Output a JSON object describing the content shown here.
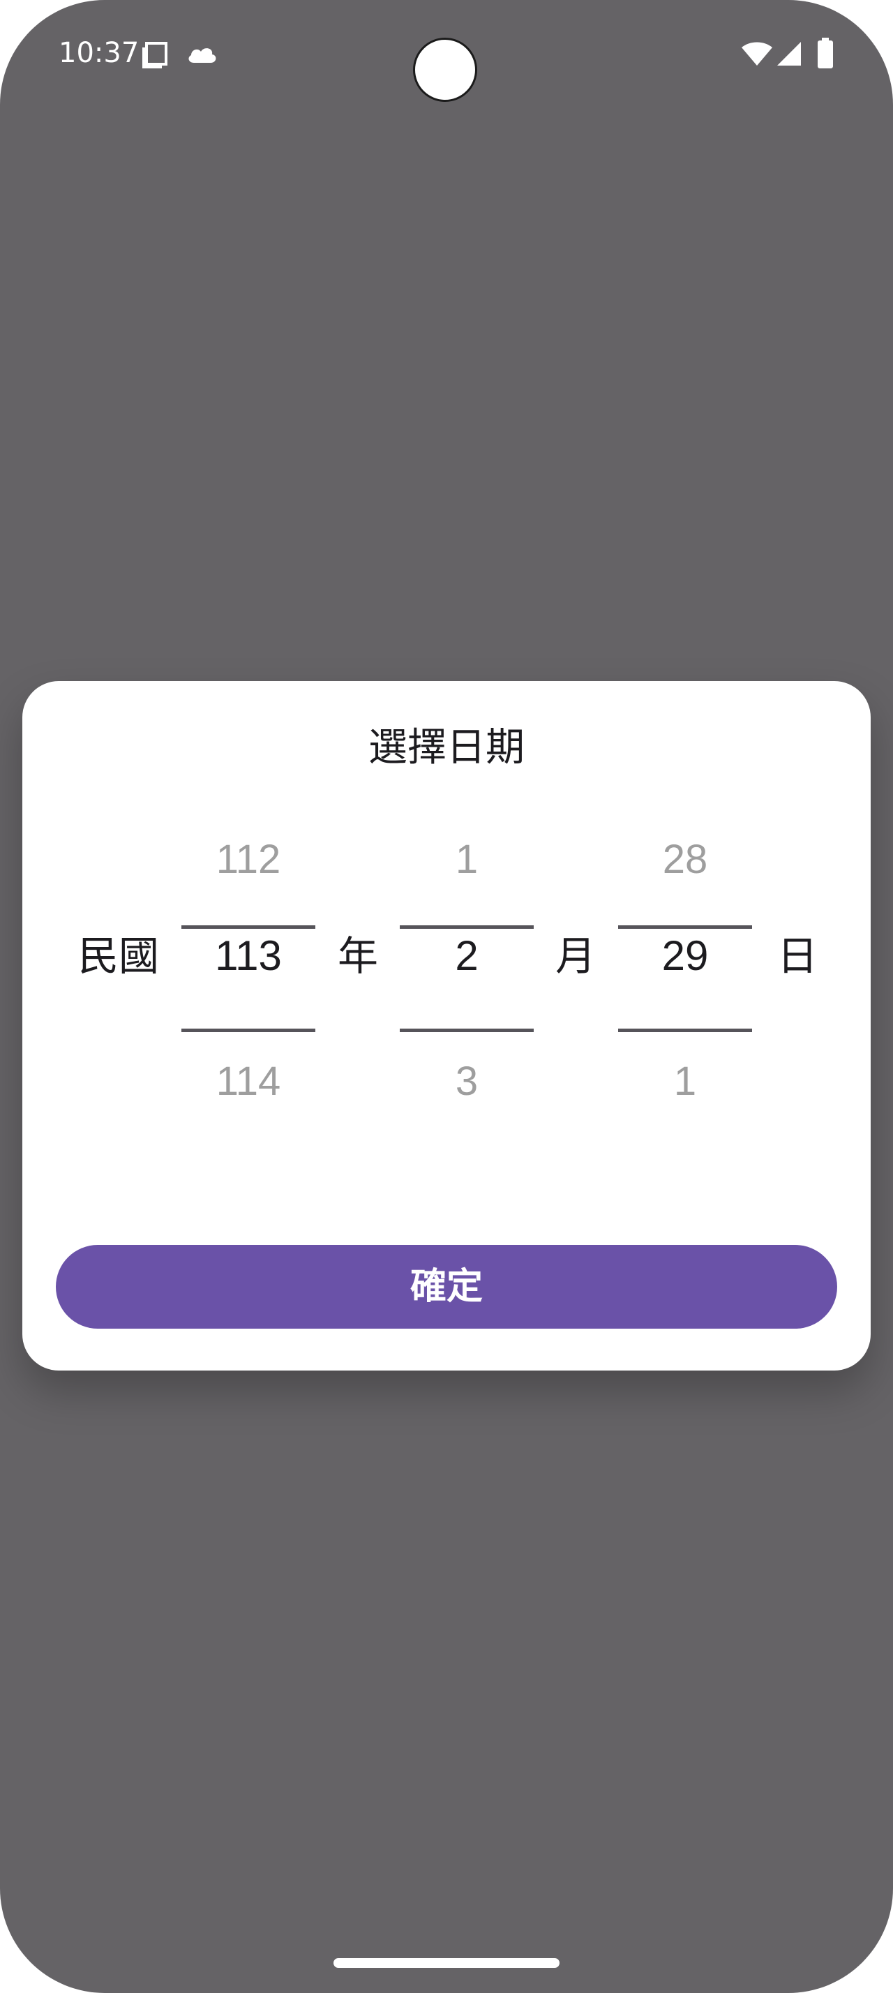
{
  "status_bar": {
    "time": "10:37",
    "icons": [
      "screenshot-icon",
      "cloud-icon",
      "wifi-icon",
      "signal-icon",
      "battery-icon"
    ]
  },
  "dialog": {
    "title": "選擇日期",
    "era_label": "民國",
    "year_label": "年",
    "month_label": "月",
    "day_label": "日",
    "year": {
      "prev": "112",
      "current": "113",
      "next": "114"
    },
    "month": {
      "prev": "1",
      "current": "2",
      "next": "3"
    },
    "day": {
      "prev": "28",
      "current": "29",
      "next": "1"
    },
    "confirm_label": "確定"
  },
  "colors": {
    "scrim": "#656366",
    "accent": "#6a52a8",
    "dialog_bg": "#ffffff",
    "dim_text": "#9e9e9e"
  }
}
